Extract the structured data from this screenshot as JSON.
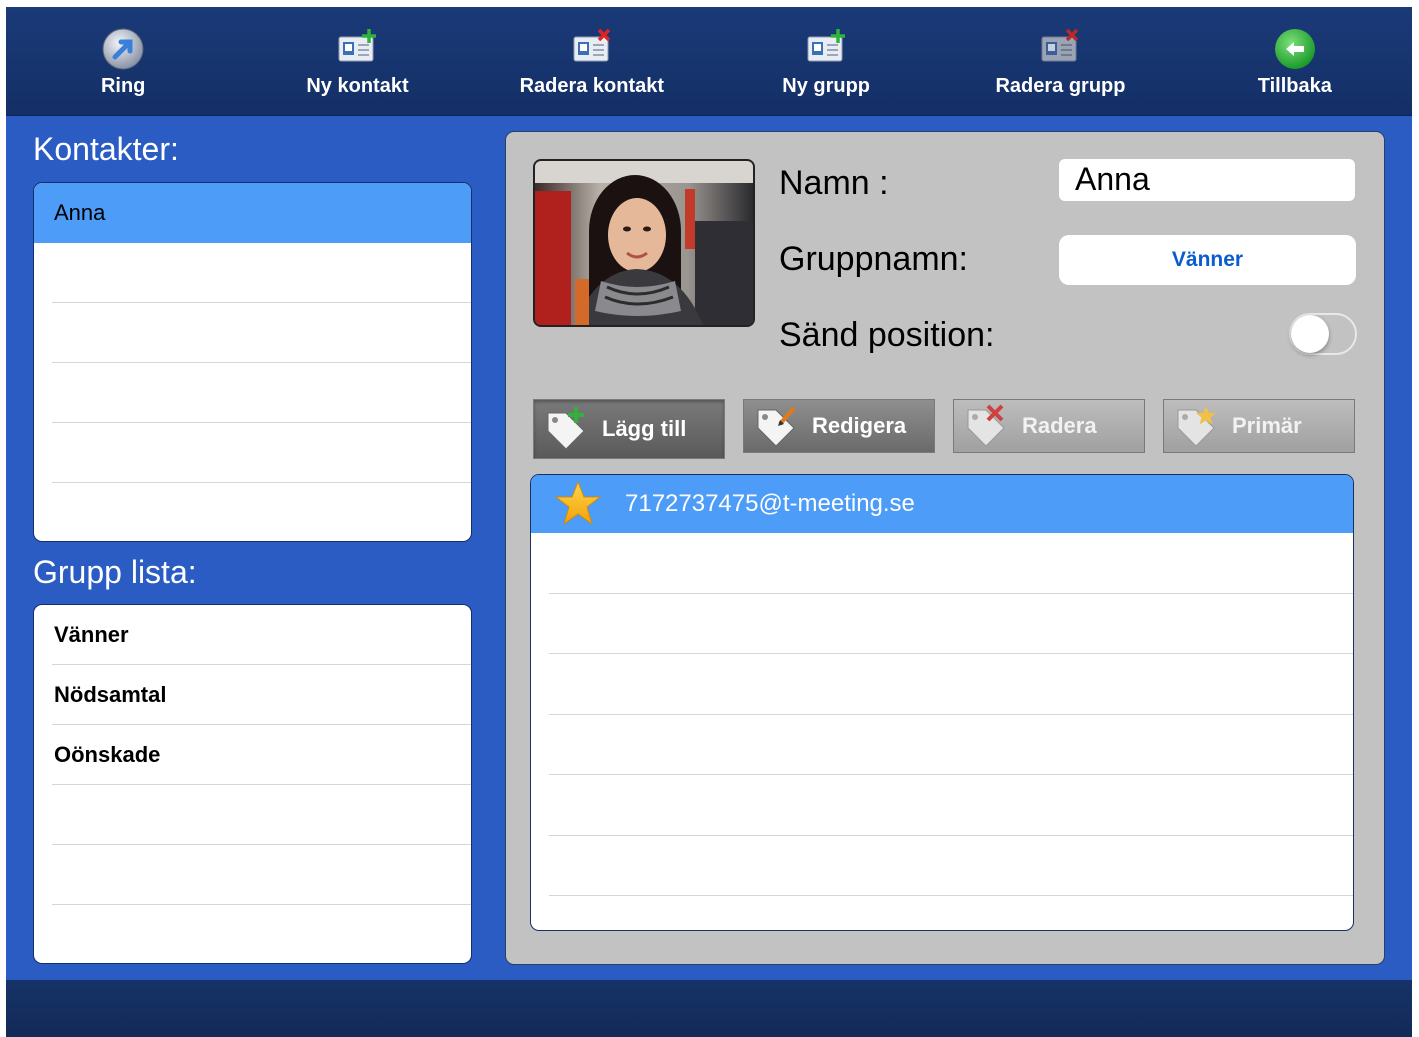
{
  "toolbar": {
    "items": [
      {
        "label": "Ring",
        "icon": "phone-call-icon"
      },
      {
        "label": "Ny kontakt",
        "icon": "add-contact-icon"
      },
      {
        "label": "Radera kontakt",
        "icon": "delete-contact-icon"
      },
      {
        "label": "Ny grupp",
        "icon": "add-group-icon"
      },
      {
        "label": "Radera grupp",
        "icon": "delete-group-icon"
      },
      {
        "label": "Tillbaka",
        "icon": "back-arrow-icon"
      }
    ]
  },
  "contacts": {
    "title": "Kontakter:",
    "items": [
      "Anna",
      "",
      "",
      "",
      "",
      ""
    ],
    "selected_index": 0
  },
  "groups": {
    "title": "Grupp lista:",
    "items": [
      "Vänner",
      "Nödsamtal",
      "Oönskade",
      "",
      "",
      ""
    ]
  },
  "detail": {
    "name_label": "Namn :",
    "name_value": "Anna",
    "group_label": "Gruppnamn:",
    "group_value": "Vänner",
    "position_label": "Sänd position:",
    "send_position_on": false,
    "actions": [
      {
        "label": "Lägg till",
        "icon": "add-tag-icon"
      },
      {
        "label": "Redigera",
        "icon": "edit-tag-icon"
      },
      {
        "label": "Radera",
        "icon": "delete-tag-icon"
      },
      {
        "label": "Primär",
        "icon": "primary-star-tag-icon"
      }
    ],
    "addresses": [
      "7172737475@t-meeting.se",
      "",
      "",
      "",
      "",
      "",
      ""
    ],
    "primary_index": 0
  },
  "colors": {
    "toolbar_bg": "#1a3a78",
    "background": "#2a5cc4",
    "selection": "#4d9cf8",
    "link_blue": "#0b5bd1",
    "panel_gray": "#c2c2c2"
  }
}
